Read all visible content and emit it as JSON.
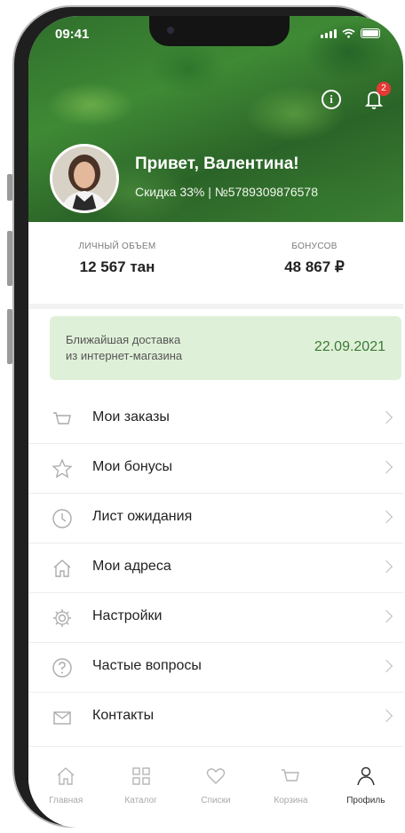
{
  "status_bar": {
    "time": "09:41"
  },
  "header": {
    "notification_count": "2",
    "greeting": "Привет, Валентина!",
    "subline": "Скидка 33% | №5789309876578"
  },
  "stats": [
    {
      "label": "ЛИЧНЫЙ ОБЪЕМ",
      "value": "12 567 тан"
    },
    {
      "label": "БОНУСОВ",
      "value": "48 867 ₽"
    }
  ],
  "delivery": {
    "label_line1": "Ближайшая доставка",
    "label_line2": "из интернет-магазина",
    "date": "22.09.2021"
  },
  "menu": [
    {
      "label": "Мои заказы",
      "icon": "cart-icon"
    },
    {
      "label": "Мои бонусы",
      "icon": "star-icon"
    },
    {
      "label": "Лист ожидания",
      "icon": "clock-icon"
    },
    {
      "label": "Мои адреса",
      "icon": "home-icon"
    },
    {
      "label": "Настройки",
      "icon": "gear-icon"
    },
    {
      "label": "Частые вопросы",
      "icon": "question-icon"
    },
    {
      "label": "Контакты",
      "icon": "envelope-icon"
    }
  ],
  "tabbar": [
    {
      "label": "Главная",
      "icon": "home-icon"
    },
    {
      "label": "Каталог",
      "icon": "grid-icon"
    },
    {
      "label": "Списки",
      "icon": "heart-icon"
    },
    {
      "label": "Корзина",
      "icon": "cart-icon"
    },
    {
      "label": "Профиль",
      "icon": "person-icon",
      "active": true
    }
  ],
  "colors": {
    "accent": "#3c7a36",
    "delivery_bg": "#dff0d8",
    "badge": "#e53935"
  }
}
